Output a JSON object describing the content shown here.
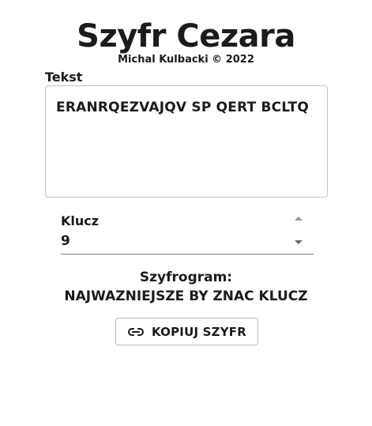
{
  "header": {
    "title": "Szyfr Cezara",
    "subtitle": "Michal Kulbacki © 2022"
  },
  "text_field": {
    "label": "Tekst",
    "value": "ERANRQEZVAJQV SP QERT BCLTQ"
  },
  "key_field": {
    "label": "Klucz",
    "value": "9"
  },
  "result": {
    "label": "Szyfrogram:",
    "value": "NAJWAZNIEJSZE BY ZNAC KLUCZ"
  },
  "copy_button": {
    "label": "KOPIUJ SZYFR",
    "icon": "link-icon"
  }
}
